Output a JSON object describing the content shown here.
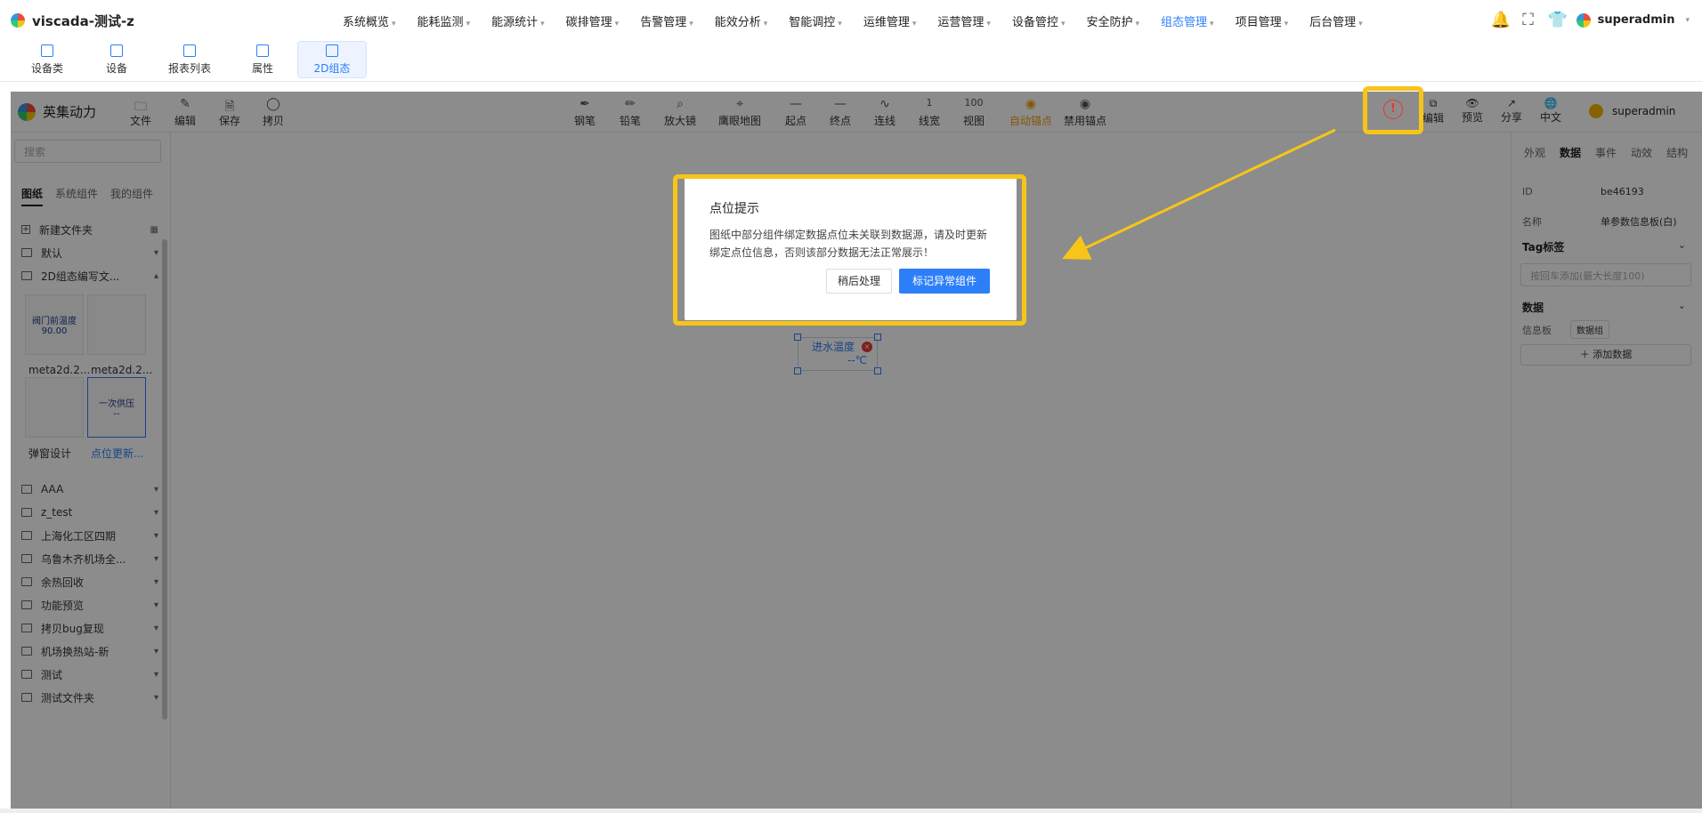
{
  "app": {
    "title": "viscada-测试-z"
  },
  "menu": [
    {
      "label": "系统概览"
    },
    {
      "label": "能耗监测"
    },
    {
      "label": "能源统计"
    },
    {
      "label": "碳排管理"
    },
    {
      "label": "告警管理"
    },
    {
      "label": "能效分析"
    },
    {
      "label": "智能调控"
    },
    {
      "label": "运维管理"
    },
    {
      "label": "运营管理"
    },
    {
      "label": "设备管控"
    },
    {
      "label": "安全防护"
    },
    {
      "label": "组态管理",
      "active": true
    },
    {
      "label": "项目管理"
    },
    {
      "label": "后台管理"
    }
  ],
  "top_right": {
    "bell_icon": "bell-icon",
    "fullscreen_icon": "fullscreen-icon",
    "shirt_icon": "shirt-icon",
    "user": "superadmin"
  },
  "subtabs": [
    {
      "label": "设备类"
    },
    {
      "label": "设备"
    },
    {
      "label": "报表列表"
    },
    {
      "label": "属性"
    },
    {
      "label": "2D组态",
      "active": true
    }
  ],
  "editor": {
    "brand": "英集动力",
    "left_tools": [
      "文件",
      "编辑",
      "保存",
      "拷贝"
    ],
    "center_tools": [
      "钢笔",
      "铅笔",
      "放大镜",
      "鹰眼地图",
      "起点",
      "终点",
      "连线",
      "线宽",
      "视图",
      "自动锚点",
      "禁用锚点"
    ],
    "line_width_value": "1",
    "view_value": "100",
    "right_tools": [
      "编辑",
      "预览",
      "分享",
      "中文"
    ],
    "user": "superadmin"
  },
  "left_panel": {
    "search_placeholder": "搜索",
    "tabs": [
      "图纸",
      "系统组件",
      "我的组件"
    ],
    "new_folder": "新建文件夹",
    "folders_top": [
      "默认",
      "2D组态编写文..."
    ],
    "thumbs": [
      {
        "caption": "meta2d.2...",
        "preview_line1": "阀门前温度",
        "preview_line2": "90.00"
      },
      {
        "caption": "meta2d.2..."
      },
      {
        "caption": "弹窗设计"
      },
      {
        "caption": "点位更新...",
        "preview_line1": "一次供压",
        "preview_line2": "--",
        "selected": true
      }
    ],
    "folders": [
      "AAA",
      "z_test",
      "上海化工区四期",
      "乌鲁木齐机场全...",
      "余热回收",
      "功能预览",
      "拷贝bug复现",
      "机场换热站-新",
      "测试",
      "测试文件夹"
    ]
  },
  "canvas": {
    "component_title": "进水温度",
    "component_value": "--℃"
  },
  "right_panel": {
    "tabs": [
      "外观",
      "数据",
      "事件",
      "动效",
      "结构"
    ],
    "active_tab": "数据",
    "id_label": "ID",
    "id_value": "be46193",
    "name_label": "名称",
    "name_value": "单参数信息板(白)",
    "tag_section": "Tag标签",
    "tag_placeholder": "按回车添加(最大长度100)",
    "data_section": "数据",
    "info_label": "信息板",
    "data_group": "数据组",
    "add_data": "添加数据"
  },
  "modal": {
    "title": "点位提示",
    "body": "图纸中部分组件绑定数据点位未关联到数据源，请及时更新绑定点位信息，否则该部分数据无法正常展示！",
    "later_btn": "稍后处理",
    "mark_btn": "标记异常组件"
  },
  "colors": {
    "accent": "#2d7ff9",
    "highlight": "#f7c518",
    "warning": "#e53935"
  }
}
